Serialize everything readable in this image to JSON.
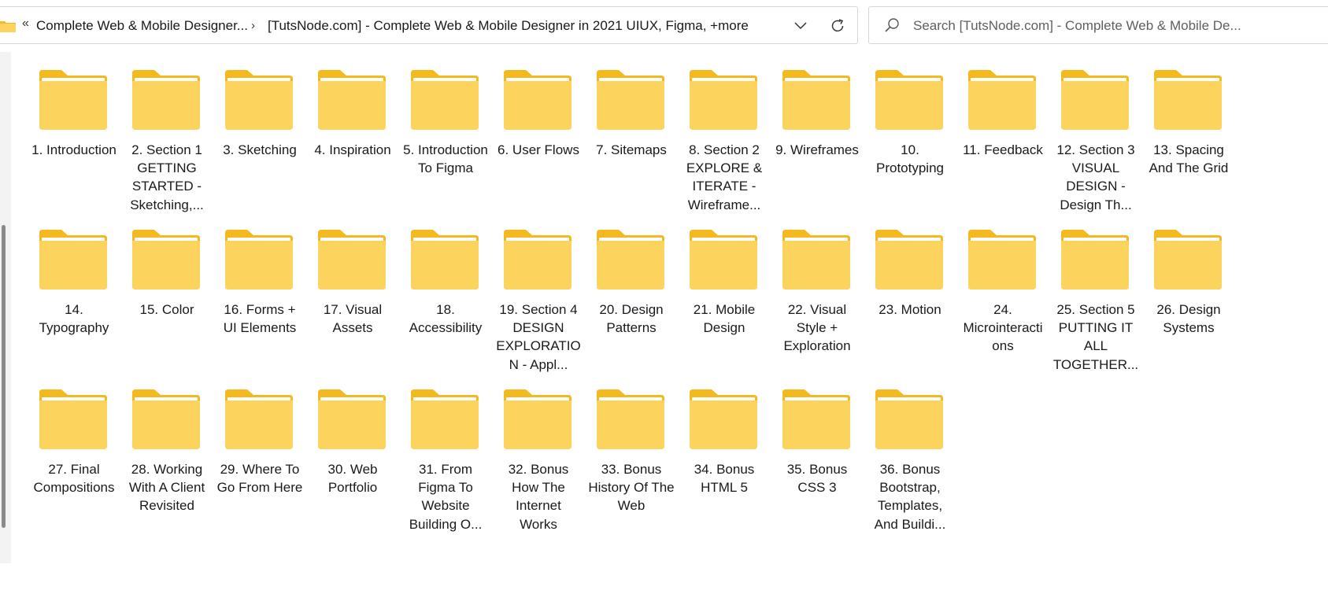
{
  "address_bar": {
    "overflow_chevron": "«",
    "crumbs": [
      "Complete Web & Mobile Designer...",
      "[TutsNode.com] - Complete Web & Mobile Designer in 2021 UIUX, Figma, +more"
    ],
    "separator": "›"
  },
  "search": {
    "placeholder": "Search [TutsNode.com] - Complete Web & Mobile De..."
  },
  "colors": {
    "folder_back": "#F4B91E",
    "folder_front": "#FCD35C",
    "folder_paper": "#FFFFFF"
  },
  "folders": [
    "1. Introduction",
    "2. Section 1 GETTING STARTED - Sketching,...",
    "3. Sketching",
    "4. Inspiration",
    "5. Introduction To Figma",
    "6. User Flows",
    "7. Sitemaps",
    "8. Section 2 EXPLORE & ITERATE - Wireframe...",
    "9. Wireframes",
    "10. Prototyping",
    "11. Feedback",
    "12. Section 3 VISUAL DESIGN - Design Th...",
    "13. Spacing And The Grid",
    "14. Typography",
    "15. Color",
    "16. Forms + UI Elements",
    "17. Visual Assets",
    "18. Accessibility",
    "19. Section 4 DESIGN EXPLORATION - Appl...",
    "20. Design Patterns",
    "21. Mobile Design",
    "22. Visual Style + Exploration",
    "23. Motion",
    "24. Microinteractions",
    "25. Section 5 PUTTING IT ALL TOGETHER...",
    "26. Design Systems",
    "27. Final Compositions",
    "28. Working With A Client Revisited",
    "29. Where To Go From Here",
    "30. Web Portfolio",
    "31. From Figma To Website Building O...",
    "32. Bonus How The Internet Works",
    "33. Bonus History Of The Web",
    "34. Bonus HTML 5",
    "35. Bonus CSS 3",
    "36. Bonus Bootstrap, Templates, And Buildi..."
  ]
}
